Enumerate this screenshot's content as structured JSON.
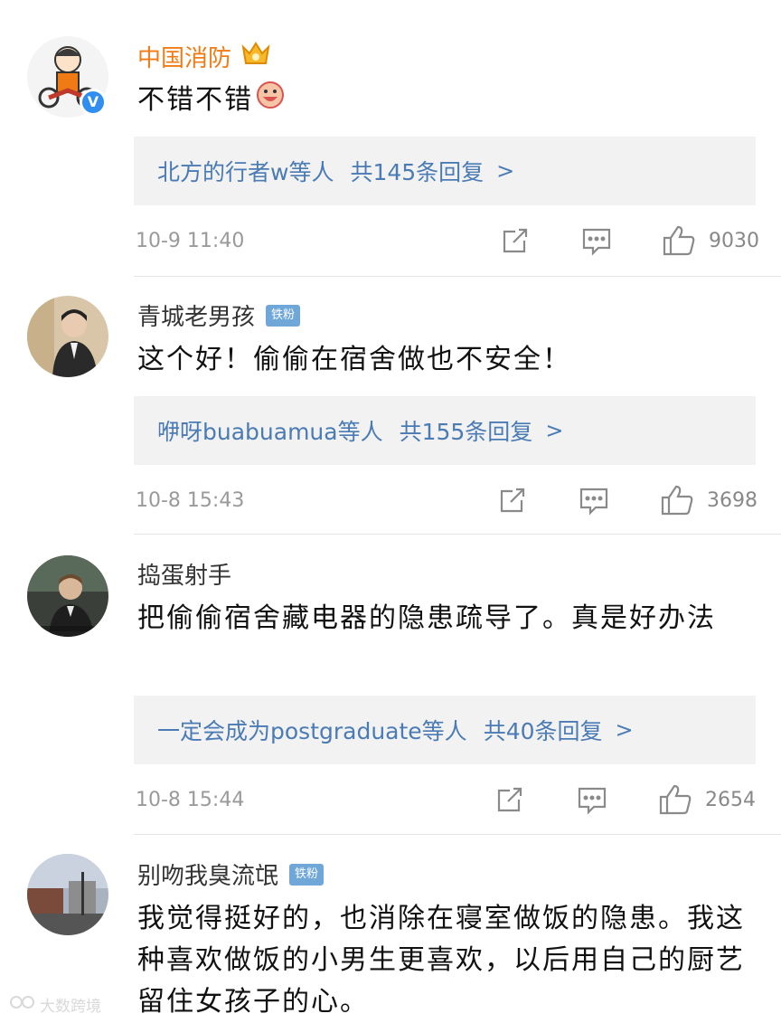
{
  "comments": [
    {
      "username": "中国消防",
      "badge": "",
      "text": "不错不错",
      "reply_users": "北方的行者w等人",
      "reply_total": "共145条回复",
      "time": "10-9 11:40",
      "likes": "9030"
    },
    {
      "username": "青城老男孩",
      "badge": "铁粉",
      "text": "这个好！偷偷在宿舍做也不安全！",
      "reply_users": "咿呀buabuamua等人",
      "reply_total": "共155条回复",
      "time": "10-8 15:43",
      "likes": "3698"
    },
    {
      "username": "捣蛋射手",
      "badge": "",
      "text": "把偷偷宿舍藏电器的隐患疏导了。真是好办法",
      "reply_users": "一定会成为postgraduate等人",
      "reply_total": "共40条回复",
      "time": "10-8 15:44",
      "likes": "2654"
    },
    {
      "username": "别吻我臭流氓",
      "badge": "铁粉",
      "text": "我觉得挺好的，也消除在寝室做饭的隐患。我这种喜欢做饭的小男生更喜欢，以后用自己的厨艺留住女孩子的心。"
    }
  ],
  "reply_arrow": ">",
  "verified_mark": "V",
  "watermark": "大数跨境",
  "colors": {
    "username_vip": "#f07b15",
    "reply_link": "#4a7bb5",
    "badge_bg": "#6fa7d9",
    "meta_text": "#9a9a9a"
  },
  "icons": [
    "share-icon",
    "comment-icon",
    "like-icon",
    "crown-icon",
    "emoji-icon",
    "verified-icon"
  ]
}
